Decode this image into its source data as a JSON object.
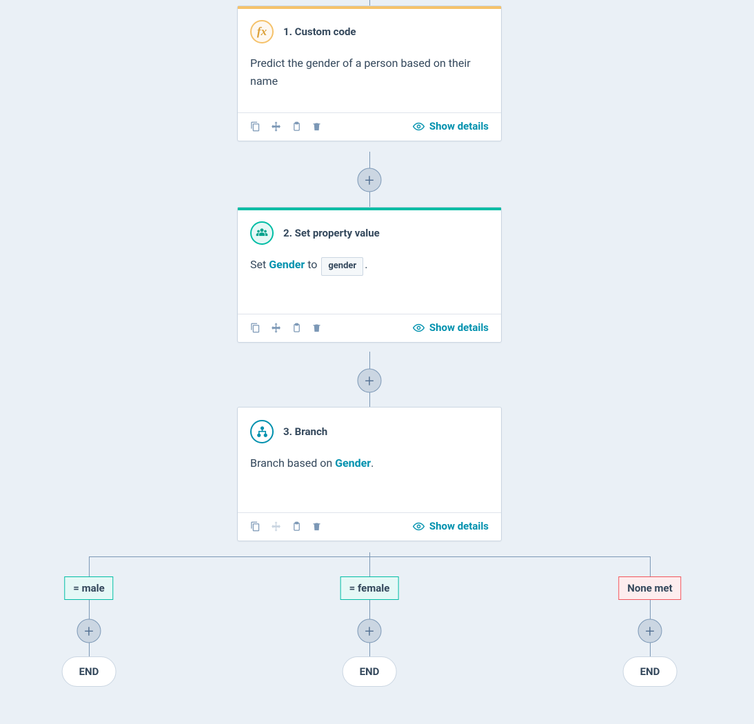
{
  "colors": {
    "stripe_yellow": "#f5c26b",
    "stripe_teal": "#00bda5",
    "icon_yellow_border": "#f5c26b",
    "icon_yellow_fill": "#fef8f0",
    "icon_yellow_glyph": "#dba039",
    "icon_teal_border": "#00bda5",
    "icon_teal_fill": "#e5f8f6",
    "icon_teal_glyph": "#00a38d",
    "accent_text": "#0091ae"
  },
  "steps": [
    {
      "number": "1",
      "kind": "custom-code",
      "title": "1. Custom code",
      "stripe": "#f5c26b",
      "icon": "fx",
      "body_text": "Predict the gender of a person based on their name",
      "footer_text": "Show details"
    },
    {
      "number": "2",
      "kind": "set-property",
      "title": "2. Set property value",
      "stripe": "#00bda5",
      "icon": "contacts",
      "body_prefix": "Set ",
      "body_property": "Gender",
      "body_middle": " to ",
      "body_token": "gender",
      "body_suffix": ".",
      "footer_text": "Show details"
    },
    {
      "number": "3",
      "kind": "branch",
      "title": "3. Branch",
      "stripe": "#ffffff",
      "icon": "branch",
      "body_prefix": "Branch based on ",
      "body_property": "Gender",
      "body_suffix": ".",
      "footer_text": "Show details"
    }
  ],
  "branches": [
    {
      "label": "= male",
      "style": "green",
      "end": "END"
    },
    {
      "label": "= female",
      "style": "green",
      "end": "END"
    },
    {
      "label": "None met",
      "style": "red",
      "end": "END"
    }
  ]
}
